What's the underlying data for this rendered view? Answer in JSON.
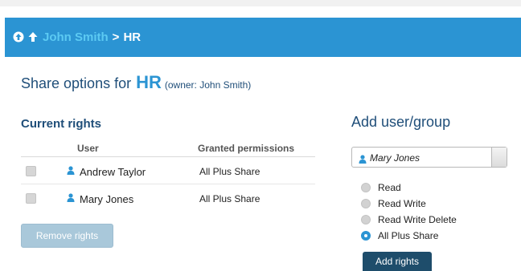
{
  "breadcrumb": {
    "parent": "John Smith",
    "separator": ">",
    "current": "HR"
  },
  "share": {
    "label": "Share options for",
    "name": "HR",
    "owner": "(owner: John Smith)"
  },
  "current_rights": {
    "title": "Current rights",
    "columns": {
      "user": "User",
      "permissions": "Granted permissions"
    },
    "rows": [
      {
        "user": "Andrew Taylor",
        "permission": "All Plus Share",
        "checked": false
      },
      {
        "user": "Mary Jones",
        "permission": "All Plus Share",
        "checked": false
      }
    ],
    "remove_label": "Remove rights"
  },
  "add": {
    "title": "Add user/group",
    "selected_user": "Mary Jones",
    "options": [
      {
        "label": "Read",
        "checked": false
      },
      {
        "label": "Read Write",
        "checked": false
      },
      {
        "label": "Read Write Delete",
        "checked": false
      },
      {
        "label": "All Plus Share",
        "checked": true
      }
    ],
    "add_label": "Add rights"
  },
  "icons": {
    "home": "circle-up-arrow-icon",
    "up": "up-arrow-icon",
    "user": "user-icon"
  },
  "colors": {
    "header_bg": "#2b94d3",
    "link": "#5ccaf3",
    "heading": "#1f4e79",
    "add_button": "#1e4d6b",
    "remove_button": "#a9c8da"
  }
}
